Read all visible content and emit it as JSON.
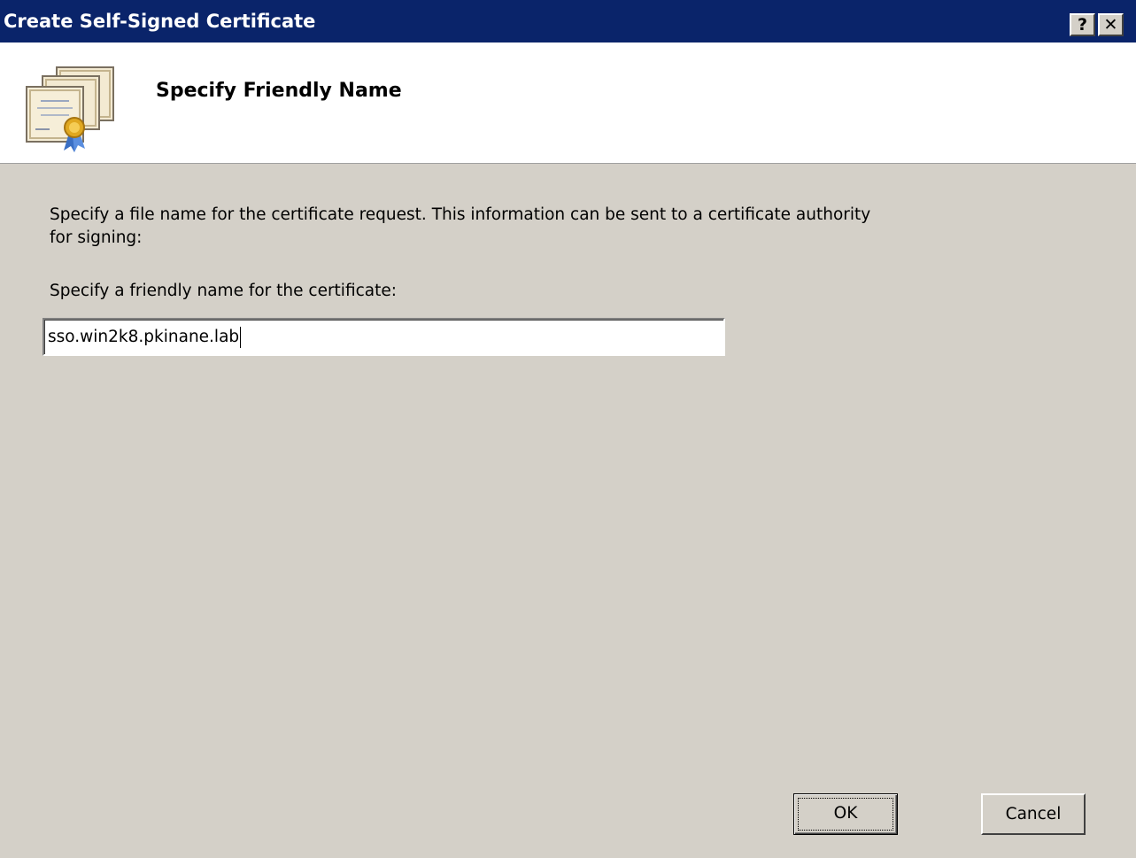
{
  "window": {
    "title": "Create Self-Signed Certificate",
    "help_button": "?",
    "close_button": "✕"
  },
  "header": {
    "title": "Specify Friendly Name",
    "icon": "certificate-icon"
  },
  "main": {
    "description_line1": "Specify a file name for the certificate request.  This information can be sent to a certificate authority",
    "description_line2": "for signing:",
    "friendly_name_label": "Specify a friendly name for the certificate:",
    "friendly_name_value": "sso.win2k8.pkinane.lab"
  },
  "buttons": {
    "ok": "OK",
    "cancel": "Cancel"
  },
  "colors": {
    "titlebar": "#0a246a",
    "dialog_background": "#d4d0c8",
    "header_background": "#ffffff"
  }
}
